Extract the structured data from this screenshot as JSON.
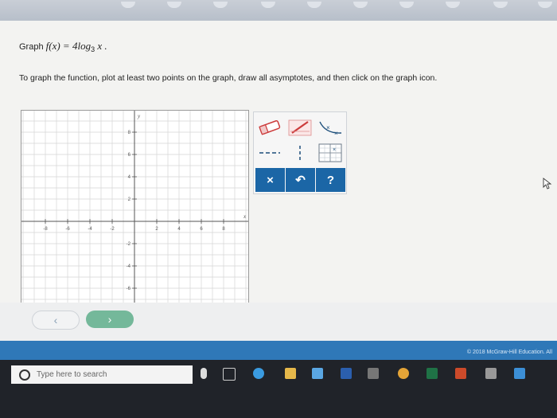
{
  "problem": {
    "lead": "Graph ",
    "function": "f(x) = 4log",
    "base": "3",
    "tail": " x ."
  },
  "instruction": "To graph the function, plot at least two points on the graph, draw all asymptotes, and then click on the graph icon.",
  "graph": {
    "x_label": "x",
    "y_label": "y",
    "x_ticks": [
      "-8",
      "-6",
      "-4",
      "-2",
      "2",
      "4",
      "6",
      "8"
    ],
    "y_ticks": [
      "8",
      "6",
      "4",
      "2",
      "-2",
      "-4",
      "-6",
      "-8"
    ]
  },
  "tools": {
    "eraser": "eraser-icon",
    "pencil": "pencil-icon",
    "curve": "curve-icon",
    "asymptote": "dashed-line-icon",
    "vertical": "vertical-line-icon",
    "graph": "graph-icon",
    "clear": "×",
    "undo": "↶",
    "help": "?"
  },
  "nav": {
    "prev": "‹",
    "next": "›"
  },
  "footer": {
    "copyright": "© 2018 McGraw-Hill Education. All"
  },
  "taskbar": {
    "search_placeholder": "Type here to search"
  },
  "colors": {
    "accent": "#1b66a6",
    "next_button": "#74b89a",
    "footer": "#2f78b8",
    "taskbar": "#202329"
  }
}
